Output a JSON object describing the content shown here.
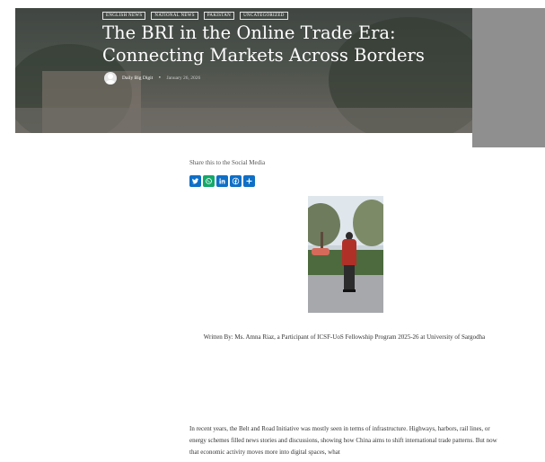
{
  "hero": {
    "categories": [
      "ENGLISH NEWS",
      "NATIONAL NEWS",
      "PAKISTAN",
      "UNCATEGORIZED"
    ],
    "title": "The BRI in the Online Trade Era: Connecting Markets Across Borders",
    "author": "Daily Big Digit",
    "separator": "•",
    "date": "January 26, 2026"
  },
  "share": {
    "label": "Share this to the Social Media",
    "buttons": [
      "twitter-icon",
      "whatsapp-icon",
      "linkedin-icon",
      "facebook-icon",
      "share-plus-icon"
    ]
  },
  "article": {
    "written_by": "Written By: Ms. Amna Riaz, a Participant of ICSF-UoS Fellowship Program 2025-26 at University of Sargodha",
    "body": "In recent years, the Belt and Road Initiative was mostly seen in terms of infrastructure. Highways, harbors, rail lines, or energy schemes filled news stories and discussions, showing how China aims to shift international trade patterns. But now that economic activity moves more into digital spaces, what"
  },
  "colors": {
    "social_blue": "#0f6fc6",
    "whatsapp_green": "#14a86a",
    "right_strip_gray": "#8f8f8f"
  }
}
